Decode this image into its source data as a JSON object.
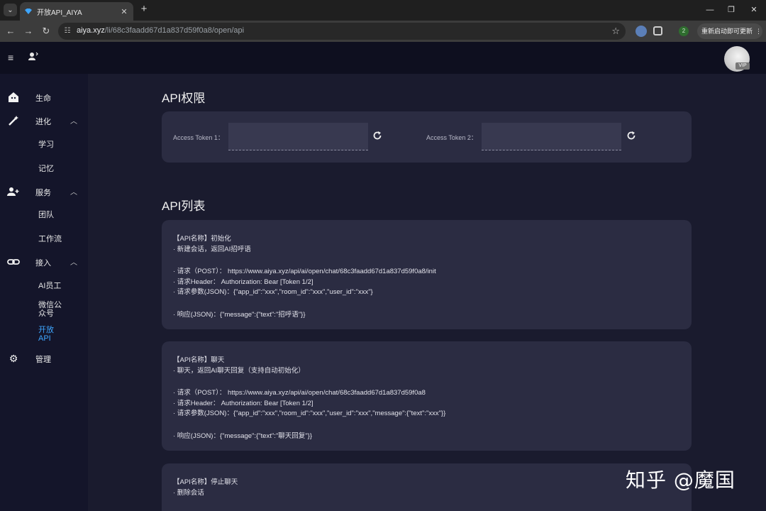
{
  "browser": {
    "tab_title": "开放API_AIYA",
    "url_host": "aiya.xyz",
    "url_path": "/li/68c3faadd67d1a837d59f0a8/open/api",
    "profile_badge": "2",
    "update_label": "重新启动即可更新"
  },
  "header": {
    "vip_badge": "VIP"
  },
  "sidebar": {
    "items": [
      {
        "label": "生命",
        "icon": "home-icon"
      },
      {
        "label": "进化",
        "icon": "magic-wand-icon",
        "subitems": [
          "学习",
          "记忆"
        ]
      },
      {
        "label": "服务",
        "icon": "people-icon",
        "subitems": [
          "团队",
          "工作流"
        ]
      },
      {
        "label": "接入",
        "icon": "link-icon",
        "subitems": [
          "AI员工",
          "微信公众号",
          "开放API"
        ]
      },
      {
        "label": "管理",
        "icon": "gear-icon"
      }
    ],
    "sub_wechat_l1": "微信公",
    "sub_wechat_l2": "众号",
    "sub_api_l1": "开放",
    "sub_api_l2": "API",
    "active": "开放API"
  },
  "permissions": {
    "title": "API权限",
    "token1_label": "Access Token 1：",
    "token1_value": "",
    "token2_label": "Access Token 2：",
    "token2_value": ""
  },
  "api_list": {
    "title": "API列表",
    "apis": [
      {
        "name": "【API名称】初始化",
        "desc": "· 新建会话，返回AI招呼语",
        "request": "· 请求（POST）： https://www.aiya.xyz/api/ai/open/chat/68c3faadd67d1a837d59f0a8/init",
        "header": "· 请求Header： Authorization: Bear [Token 1/2]",
        "params": "· 请求参数(JSON)：{\"app_id\":\"xxx\",\"room_id\":\"xxx\",\"user_id\":\"xxx\"}",
        "response": "· 响应(JSON)：{\"message\":{\"text\":\"招呼语\"}}"
      },
      {
        "name": "【API名称】聊天",
        "desc": "· 聊天，返回AI聊天回复（支持自动初始化）",
        "request": "· 请求（POST）： https://www.aiya.xyz/api/ai/open/chat/68c3faadd67d1a837d59f0a8",
        "header": "· 请求Header： Authorization: Bear [Token 1/2]",
        "params": "· 请求参数(JSON)：{\"app_id\":\"xxx\",\"room_id\":\"xxx\",\"user_id\":\"xxx\",\"message\":{\"text\":\"xxx\"}}",
        "response": "· 响应(JSON)：{\"message\":{\"text\":\"聊天回复\"}}"
      },
      {
        "name": "【API名称】停止聊天",
        "desc": "· 删除会话"
      }
    ]
  },
  "watermark": "知乎 @魔国"
}
